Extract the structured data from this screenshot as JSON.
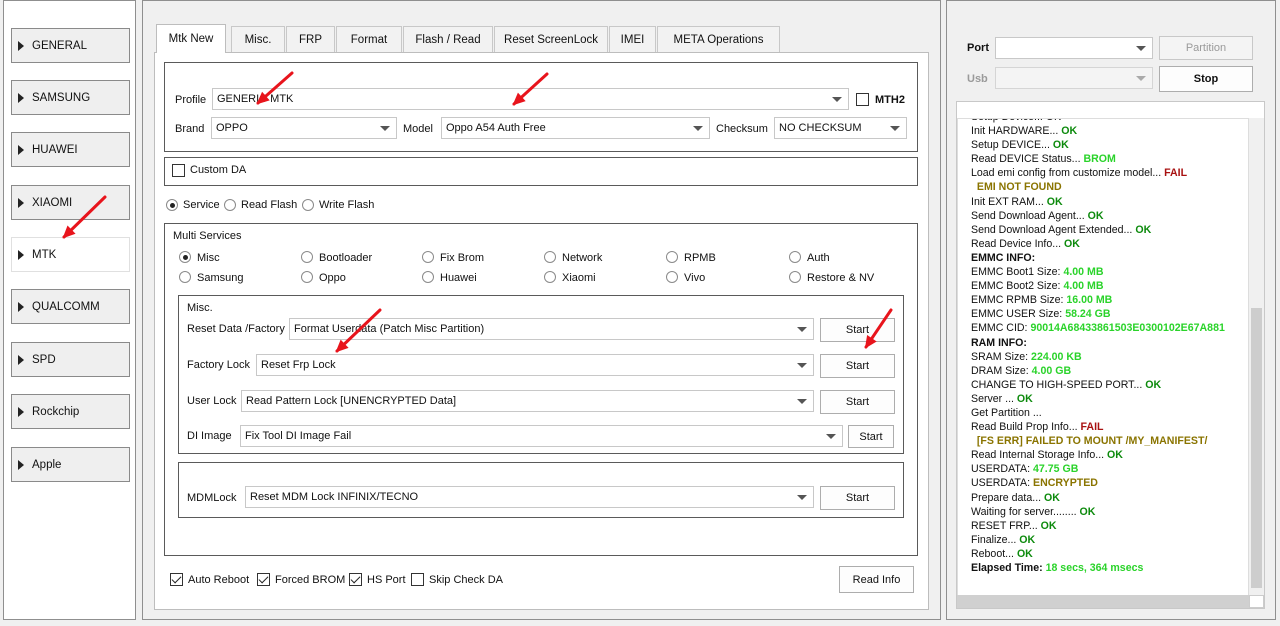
{
  "sidebar": {
    "items": [
      {
        "label": "GENERAL"
      },
      {
        "label": "SAMSUNG"
      },
      {
        "label": "HUAWEI"
      },
      {
        "label": "XIAOMI"
      },
      {
        "label": "MTK",
        "active": true
      },
      {
        "label": "QUALCOMM"
      },
      {
        "label": "SPD"
      },
      {
        "label": "Rockchip"
      },
      {
        "label": "Apple"
      }
    ]
  },
  "tabs": [
    "Mtk New",
    "Misc.",
    "FRP",
    "Format",
    "Flash / Read",
    "Reset ScreenLock",
    "IMEI",
    "META Operations"
  ],
  "profile": {
    "label": "Profile",
    "value": "GENERIC MTK",
    "mth2_label": "MTH2"
  },
  "brand": {
    "label": "Brand",
    "value": "OPPO"
  },
  "model": {
    "label": "Model",
    "value": "Oppo A54 Auth Free"
  },
  "checksum": {
    "label": "Checksum",
    "value": "NO CHECKSUM"
  },
  "custom_da": {
    "label": "Custom DA"
  },
  "modes": [
    {
      "label": "Service",
      "selected": true
    },
    {
      "label": "Read Flash",
      "selected": false
    },
    {
      "label": "Write Flash",
      "selected": false
    }
  ],
  "multi_services": {
    "title": "Multi Services",
    "options": [
      "Misc",
      "Bootloader",
      "Fix Brom",
      "Network",
      "RPMB",
      "Auth",
      "Samsung",
      "Oppo",
      "Huawei",
      "Xiaomi",
      "Vivo",
      "Restore & NV"
    ],
    "selected": "Misc"
  },
  "misc": {
    "title": "Misc.",
    "rows": [
      {
        "label": "Reset Data /Factory",
        "value": "Format Userdata (Patch Misc Partition)",
        "button": "Start"
      },
      {
        "label": "Factory Lock",
        "value": "Reset Frp Lock",
        "button": "Start"
      },
      {
        "label": "User Lock",
        "value": "Read Pattern Lock [UNENCRYPTED Data]",
        "button": "Start"
      },
      {
        "label": "DI Image",
        "value": "Fix Tool DI Image Fail",
        "button": "Start"
      }
    ]
  },
  "mdm": {
    "label": "MDMLock",
    "value": "Reset MDM Lock INFINIX/TECNO",
    "button": "Start"
  },
  "footer": {
    "checks": [
      {
        "label": "Auto Reboot",
        "checked": true
      },
      {
        "label": "Forced BROM",
        "checked": true
      },
      {
        "label": "HS Port",
        "checked": true
      },
      {
        "label": "Skip Check DA",
        "checked": false
      }
    ],
    "read_info": "Read Info"
  },
  "right": {
    "port_label": "Port",
    "usb_label": "Usb",
    "partition_button": "Partition",
    "stop_button": "Stop"
  },
  "log": [
    [
      {
        "t": "Setup Device... OK",
        "c": ""
      }
    ],
    [
      {
        "t": "Init HARDWARE... ",
        "c": ""
      },
      {
        "t": "OK",
        "c": "ok"
      }
    ],
    [
      {
        "t": "Setup DEVICE... ",
        "c": ""
      },
      {
        "t": "OK",
        "c": "ok"
      }
    ],
    [
      {
        "t": "Read DEVICE Status... ",
        "c": ""
      },
      {
        "t": "BROM",
        "c": "grn"
      }
    ],
    [
      {
        "t": "Load emi config from customize model... ",
        "c": ""
      },
      {
        "t": "FAIL",
        "c": "fail"
      }
    ],
    [
      {
        "t": "  EMI NOT FOUND",
        "c": "brn"
      }
    ],
    [
      {
        "t": "Init EXT RAM... ",
        "c": ""
      },
      {
        "t": "OK",
        "c": "ok"
      }
    ],
    [
      {
        "t": "Send Download Agent... ",
        "c": ""
      },
      {
        "t": "OK",
        "c": "ok"
      }
    ],
    [
      {
        "t": "Send Download Agent Extended... ",
        "c": ""
      },
      {
        "t": "OK",
        "c": "ok"
      }
    ],
    [
      {
        "t": "Read Device Info... ",
        "c": ""
      },
      {
        "t": "OK",
        "c": "ok"
      }
    ],
    [
      {
        "t": "EMMC INFO:",
        "c": "bold"
      }
    ],
    [
      {
        "t": "EMMC Boot1 Size: ",
        "c": ""
      },
      {
        "t": "4.00 MB",
        "c": "grn"
      }
    ],
    [
      {
        "t": "EMMC Boot2 Size: ",
        "c": ""
      },
      {
        "t": "4.00 MB",
        "c": "grn"
      }
    ],
    [
      {
        "t": "EMMC RPMB Size: ",
        "c": ""
      },
      {
        "t": "16.00 MB",
        "c": "grn"
      }
    ],
    [
      {
        "t": "EMMC USER Size: ",
        "c": ""
      },
      {
        "t": "58.24 GB",
        "c": "grn"
      }
    ],
    [
      {
        "t": "EMMC CID: ",
        "c": ""
      },
      {
        "t": "90014A68433861503E0300102E67A881",
        "c": "grn"
      }
    ],
    [
      {
        "t": "RAM INFO:",
        "c": "bold"
      }
    ],
    [
      {
        "t": "SRAM Size: ",
        "c": ""
      },
      {
        "t": "224.00 KB",
        "c": "grn"
      }
    ],
    [
      {
        "t": "DRAM Size: ",
        "c": ""
      },
      {
        "t": "4.00 GB",
        "c": "grn"
      }
    ],
    [
      {
        "t": "CHANGE TO HIGH-SPEED PORT... ",
        "c": ""
      },
      {
        "t": "OK",
        "c": "ok"
      }
    ],
    [
      {
        "t": "Server ... ",
        "c": ""
      },
      {
        "t": "OK",
        "c": "ok"
      }
    ],
    [
      {
        "t": "Get Partition ...",
        "c": ""
      }
    ],
    [
      {
        "t": "Read Build Prop Info... ",
        "c": ""
      },
      {
        "t": "FAIL",
        "c": "fail"
      }
    ],
    [
      {
        "t": "  [FS ERR] FAILED TO MOUNT /MY_MANIFEST/",
        "c": "brn"
      }
    ],
    [
      {
        "t": "Read Internal Storage Info... ",
        "c": ""
      },
      {
        "t": "OK",
        "c": "ok"
      }
    ],
    [
      {
        "t": "USERDATA: ",
        "c": ""
      },
      {
        "t": "47.75 GB",
        "c": "grn"
      }
    ],
    [
      {
        "t": "USERDATA: ",
        "c": ""
      },
      {
        "t": "ENCRYPTED",
        "c": "brn"
      }
    ],
    [
      {
        "t": "Prepare data... ",
        "c": ""
      },
      {
        "t": "OK",
        "c": "ok"
      }
    ],
    [
      {
        "t": "Waiting for server........ ",
        "c": ""
      },
      {
        "t": "OK",
        "c": "ok"
      }
    ],
    [
      {
        "t": "RESET FRP... ",
        "c": ""
      },
      {
        "t": "OK",
        "c": "ok"
      }
    ],
    [
      {
        "t": "Finalize... ",
        "c": ""
      },
      {
        "t": "OK",
        "c": "ok"
      }
    ],
    [
      {
        "t": "Reboot... ",
        "c": ""
      },
      {
        "t": "OK",
        "c": "ok"
      }
    ],
    [
      {
        "t": "Elapsed Time: ",
        "c": "bold"
      },
      {
        "t": "18 secs, 364 msecs",
        "c": "grn"
      }
    ]
  ],
  "colors": {
    "annotation_arrow": "#e8141c",
    "ok": "#0c8a0c",
    "fail": "#a81111",
    "value": "#2ad32a"
  }
}
